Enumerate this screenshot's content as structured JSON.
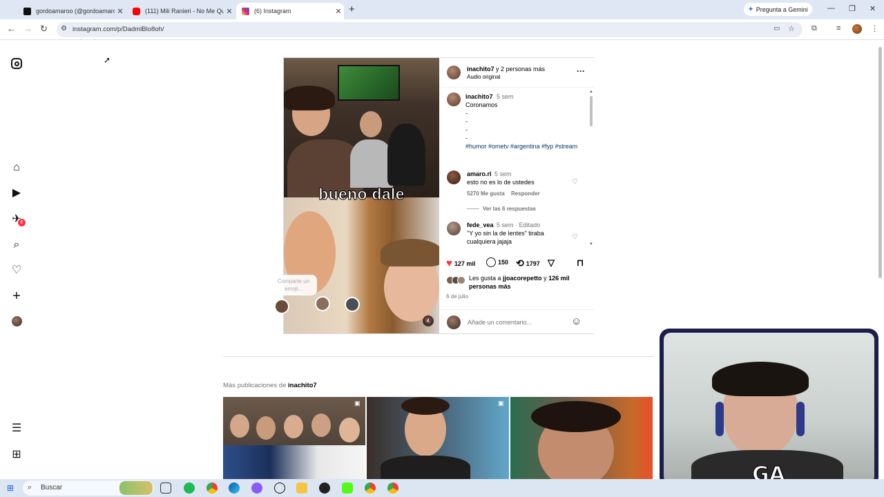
{
  "browser": {
    "tabs": [
      {
        "title": "gordoamaroo (@gordoamaroo",
        "icon": "tiktok-icon",
        "color": "#111111"
      },
      {
        "title": "(111) Mili Ranieri - No Me Quer",
        "icon": "youtube-icon",
        "color": "#ff0000"
      },
      {
        "title": "(6) Instagram",
        "icon": "instagram-icon",
        "color": "#d62976"
      }
    ],
    "url": "instagram.com/p/DadmlBlo8oh/",
    "gemini_label": "Pregunta a Gemini"
  },
  "sidebar": {
    "notifications_badge": "6"
  },
  "post": {
    "header": {
      "author": "inachito7",
      "coauthors": " y 2 personas más",
      "audio": "Audio original"
    },
    "video_caption": "bueno dale",
    "emoji_prompt": "Comparte un emoji...",
    "caption": {
      "user": "inachito7",
      "time": "5 sem",
      "lines": [
        "Coronamos",
        "-",
        "-",
        "-",
        "-"
      ],
      "hashtags": "#humor #ometv #argentina #fyp #stream"
    },
    "comments": [
      {
        "user": "amaro.rl",
        "time": "5 sem",
        "text": "esto no es lo de ustedes",
        "likes": "5270 Me gusta",
        "reply": "Responder",
        "view_replies": "Ver las 6 respuestas"
      },
      {
        "user": "fede_vea",
        "time": "5 sem · Editado",
        "text": "\"Y yo sin la de lentes\" tiraba cualquiera jajaja"
      }
    ],
    "actions": {
      "likes": "127 mil",
      "comments": "150",
      "reposts": "1797"
    },
    "liked_by": {
      "prefix": "Les gusta a ",
      "user": "jjoacorepetto",
      "middle": " y ",
      "others": "126 mil personas más"
    },
    "date": "6 de julio",
    "add_comment_placeholder": "Añade un comentario..."
  },
  "more_posts": {
    "prefix": "Más publicaciones de ",
    "user": "inachito7"
  },
  "webcam_overlay": "GA",
  "taskbar": {
    "search": "Buscar"
  }
}
